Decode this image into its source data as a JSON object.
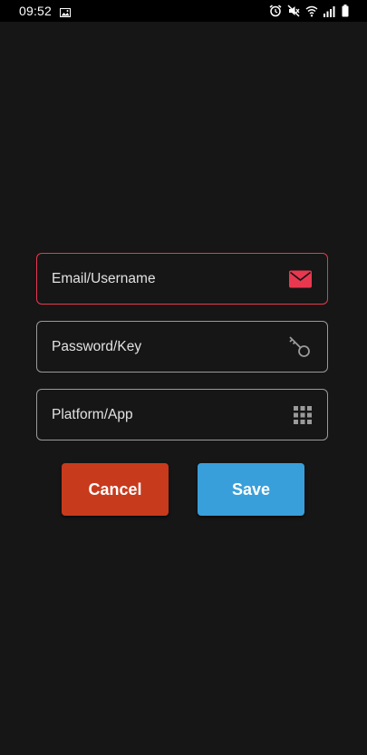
{
  "status_bar": {
    "time": "09:52",
    "icons": [
      "gallery-icon",
      "alarm-icon",
      "mute-icon",
      "wifi-icon",
      "signal-icon",
      "battery-icon"
    ]
  },
  "form": {
    "fields": [
      {
        "label": "Email/Username",
        "icon": "mail-icon",
        "focused": true
      },
      {
        "label": "Password/Key",
        "icon": "key-icon",
        "focused": false
      },
      {
        "label": "Platform/App",
        "icon": "grid-icon",
        "focused": false
      }
    ]
  },
  "buttons": {
    "cancel": "Cancel",
    "save": "Save"
  },
  "colors": {
    "background": "#161616",
    "focus_border": "#e8384f",
    "mail_icon": "#e8384f",
    "cancel": "#c83a1c",
    "save": "#399fda"
  }
}
